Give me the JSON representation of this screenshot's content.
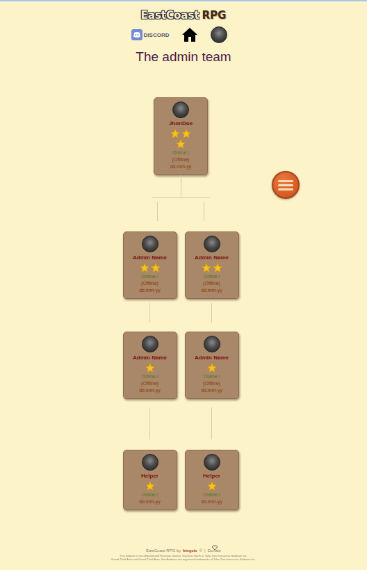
{
  "header": {
    "logo": {
      "main": "EastCoast",
      "accent": "RPG"
    },
    "discord_label": "DISCORD"
  },
  "title": "The admin team",
  "tiers": [
    {
      "members": [
        {
          "name": "JhonDoe",
          "stars": 3,
          "online": "Online /",
          "offline": "(Offline)",
          "date": "dd.mm-yy"
        }
      ]
    },
    {
      "members": [
        {
          "name": "Admin Name",
          "stars": 2,
          "online": "Online /",
          "offline": "(Offline)",
          "date": "dd.mm-yy"
        },
        {
          "name": "Admin Name",
          "stars": 2,
          "online": "Online /",
          "offline": "(Offline)",
          "date": "dd.mm-yy"
        }
      ]
    },
    {
      "members": [
        {
          "name": "Admin Name",
          "stars": 1,
          "online": "Online /",
          "offline": "(Offline)",
          "date": "dd.mm-yy"
        },
        {
          "name": "Admin Name",
          "stars": 1,
          "online": "Online /",
          "offline": "(Offline)",
          "date": "dd.mm-yy"
        }
      ]
    },
    {
      "members": [
        {
          "name": "Helper",
          "stars": 1,
          "online": "Online /",
          "date": "dd.mm-yy"
        },
        {
          "name": "Helper",
          "stars": 1,
          "online": "Online /",
          "date": "dd.mm-yy"
        }
      ]
    }
  ],
  "footer": {
    "prefix": "EastCoast RPG by",
    "author": "kingzix",
    "copyright": "©",
    "separator": "|",
    "donate": "Donate",
    "disclaimer": [
      "This website is not affiliated with Rockstar Games, Rockstar North or Take-Two Interactive Software Inc.",
      "Grand Theft Auto and Grand Theft Auto: San Andreas are registered trademarks of Take-Two Interactive Software Inc."
    ]
  }
}
